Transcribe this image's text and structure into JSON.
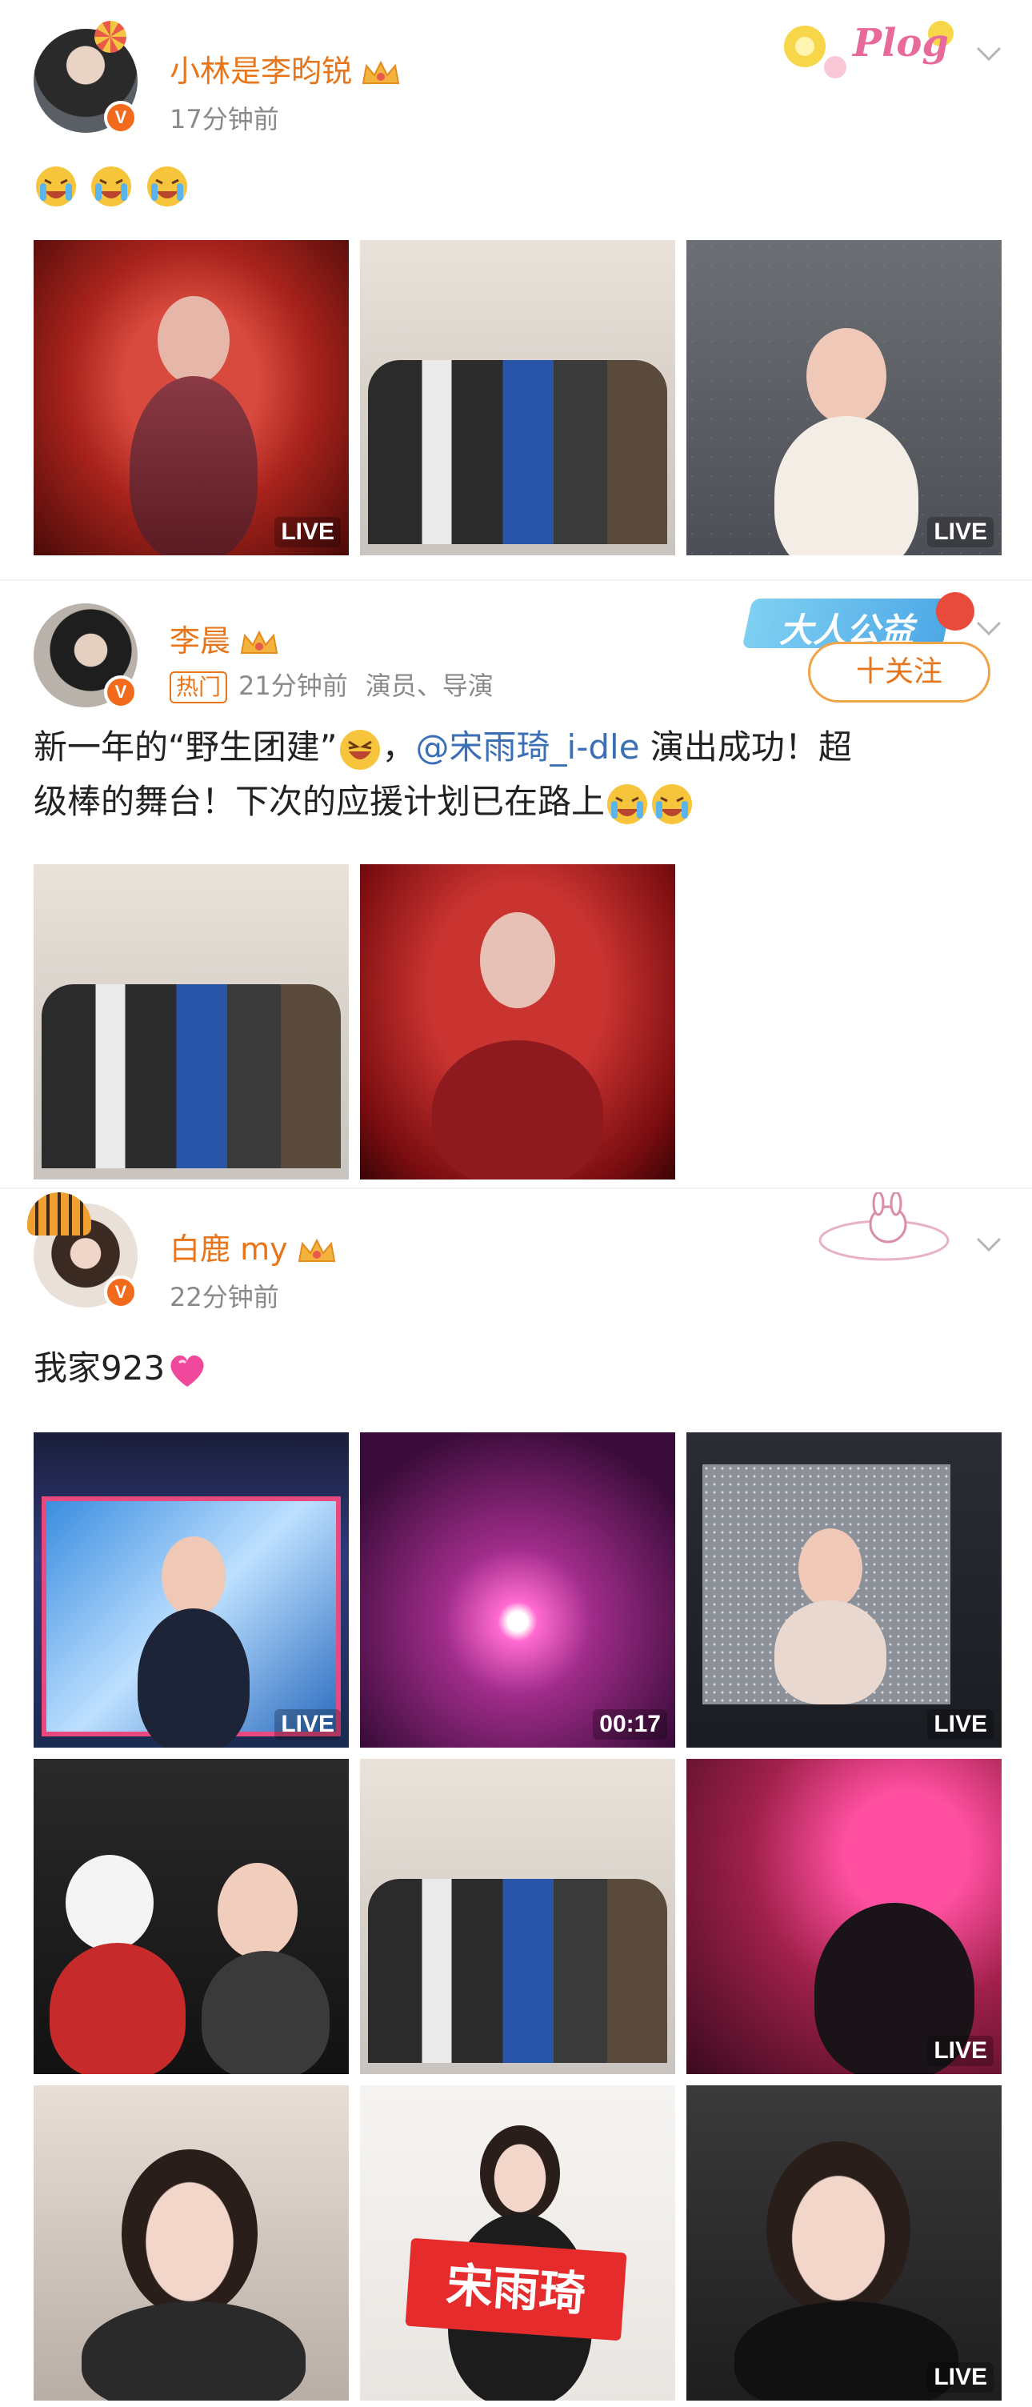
{
  "posts": [
    {
      "username": "小林是李昀锐",
      "time": "17分钟前",
      "photos": [
        {
          "label": "LIVE"
        },
        {
          "label": ""
        },
        {
          "label": "LIVE"
        }
      ],
      "deco_text": "Plog"
    },
    {
      "username": "李晨",
      "hot_tag": "热门",
      "time": "21分钟前",
      "profession": "演员、导演",
      "follow_label": "十关注",
      "text_before": "新一年的“野生团建”",
      "text_comma": "，",
      "mention": "@宋雨琦_i-dle",
      "text_after1": " 演出成功！超",
      "text_after2": "级棒的舞台！下次的应援计划已在路上",
      "deco_text": "大人公益"
    },
    {
      "username": "白鹿 my",
      "time": "22分钟前",
      "text": "我家923",
      "photos": [
        {
          "label": "LIVE"
        },
        {
          "label": "00:17"
        },
        {
          "label": "LIVE"
        },
        {
          "label": ""
        },
        {
          "label": ""
        },
        {
          "label": "LIVE"
        },
        {
          "label": ""
        },
        {
          "label": ""
        },
        {
          "label": "LIVE"
        }
      ],
      "sign_text": "宋雨琦"
    }
  ],
  "colors": {
    "username": "#e8751a",
    "meta": "#8a8a8a",
    "mention": "#3b6fb6",
    "verified": "#f26b1d"
  }
}
